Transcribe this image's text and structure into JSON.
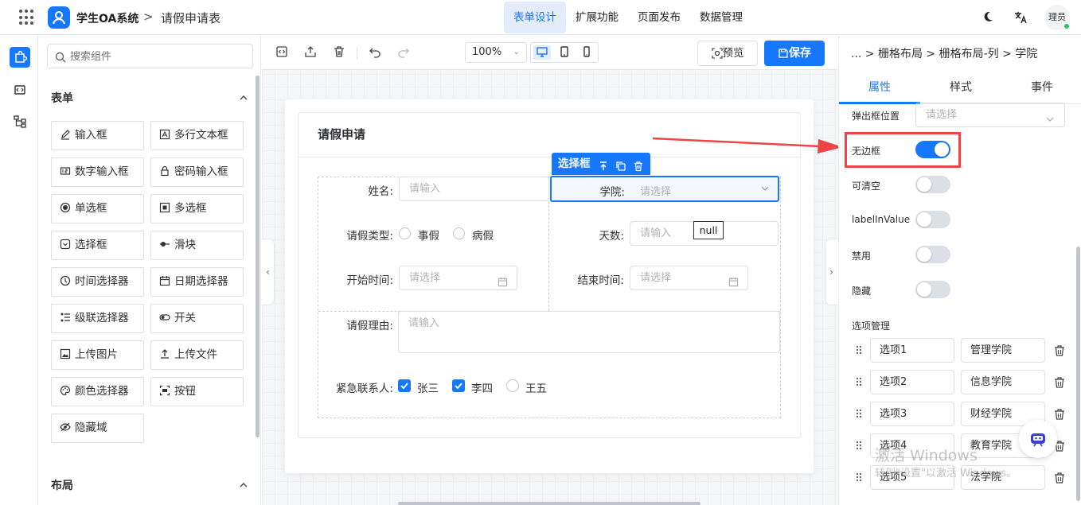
{
  "header": {
    "brand": "学生OA系统",
    "separator": ">",
    "page_title": "请假申请表",
    "nav": [
      "表单设计",
      "扩展功能",
      "页面发布",
      "数据管理"
    ],
    "nav_active": 0,
    "user": "理员"
  },
  "components": {
    "search_placeholder": "搜索组件",
    "form_section": "表单",
    "items": [
      "输入框",
      "多行文本框",
      "数字输入框",
      "密码输入框",
      "单选框",
      "多选框",
      "选择框",
      "滑块",
      "时间选择器",
      "日期选择器",
      "级联选择器",
      "开关",
      "上传图片",
      "上传文件",
      "颜色选择器",
      "按钮",
      "隐藏域"
    ],
    "layout_section": "布局"
  },
  "toolbar": {
    "zoom": "100%",
    "preview": "预览",
    "save": "保存"
  },
  "form": {
    "title": "请假申请",
    "name_label": "姓名:",
    "name_placeholder": "请输入",
    "college_label": "学院:",
    "college_placeholder": "请选择",
    "type_label": "请假类型:",
    "type_options": [
      "事假",
      "病假"
    ],
    "days_label": "天数:",
    "days_placeholder": "请输入",
    "null_tip": "null",
    "start_label": "开始时间:",
    "start_placeholder": "请选择",
    "end_label": "结束时间:",
    "end_placeholder": "请选择",
    "reason_label": "请假理由:",
    "reason_placeholder": "请输入",
    "contact_label": "紧急联系人:",
    "contacts": [
      {
        "label": "张三",
        "checked": true
      },
      {
        "label": "李四",
        "checked": true
      },
      {
        "label": "王五",
        "checked": false
      }
    ],
    "selected_widget_label": "选择框"
  },
  "props": {
    "breadcrumb": "... > 栅格布局 > 栅格布局-列 > 学院",
    "tabs": [
      "属性",
      "样式",
      "事件"
    ],
    "active_tab": 0,
    "popup_position_label": "弹出框位置",
    "popup_position_placeholder": "请选择",
    "switches": [
      {
        "label": "无边框",
        "on": true
      },
      {
        "label": "可清空",
        "on": false
      },
      {
        "label": "labelInValue",
        "on": false
      },
      {
        "label": "禁用",
        "on": false
      },
      {
        "label": "隐藏",
        "on": false
      }
    ],
    "options_title": "选项管理",
    "options": [
      {
        "key": "选项1",
        "value": "管理学院"
      },
      {
        "key": "选项2",
        "value": "信息学院"
      },
      {
        "key": "选项3",
        "value": "财经学院"
      },
      {
        "key": "选项4",
        "value": "教育学院"
      },
      {
        "key": "选项5",
        "value": "法学院"
      }
    ]
  },
  "watermark": {
    "line1": "激活 Windows",
    "line2": "转到\"设置\"以激活 Windows。"
  },
  "colors": {
    "accent": "#1677ff",
    "highlight": "#ef4444"
  }
}
